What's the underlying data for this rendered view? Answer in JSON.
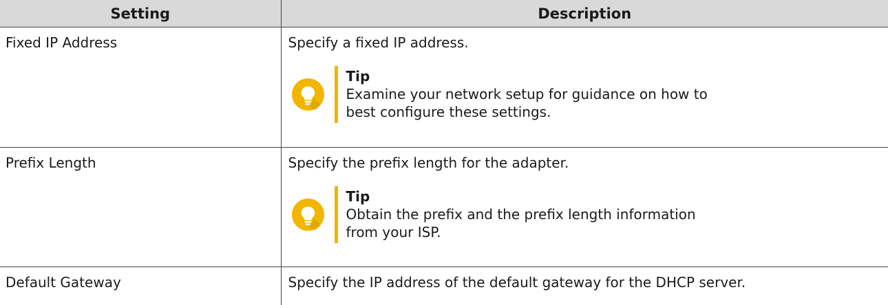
{
  "table": {
    "headers": [
      "Setting",
      "Description"
    ],
    "rows": [
      {
        "setting": "Fixed IP Address",
        "description": "Specify a fixed IP address.",
        "tip": {
          "title": "Tip",
          "text": "Examine your network setup for guidance on how to best configure these settings.",
          "icon": "lightbulb-icon"
        }
      },
      {
        "setting": "Prefix Length",
        "description": "Specify the prefix length for the adapter.",
        "tip": {
          "title": "Tip",
          "text": "Obtain the prefix and the prefix length information from your ISP.",
          "icon": "lightbulb-icon"
        }
      },
      {
        "setting": "Default Gateway",
        "description": "Specify the IP address of the default gateway for the DHCP server."
      }
    ]
  },
  "colors": {
    "header_bg": "#d9d9d9",
    "tip_accent": "#f2b500",
    "border": "#444444"
  }
}
